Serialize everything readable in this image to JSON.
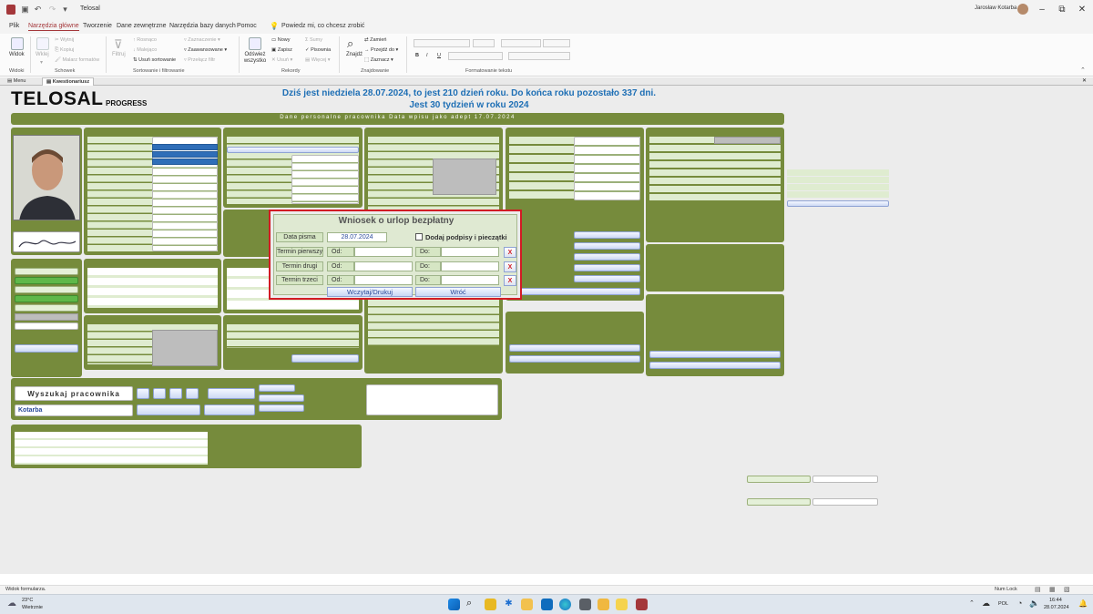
{
  "window": {
    "app_title": "Telosal",
    "user_name": "Jarosław Kotarba"
  },
  "ribbon": {
    "tabs": [
      "Plik",
      "Narzędzia główne",
      "Tworzenie",
      "Dane zewnętrzne",
      "Narzędzia bazy danych",
      "Pomoc"
    ],
    "active_tab": "Narzędzia główne",
    "tell_me": "Powiedz mi, co chcesz zrobić",
    "groups": {
      "widoki": {
        "label": "Widoki",
        "view_button": "Widok"
      },
      "schowek": {
        "label": "Schowek",
        "paste": "Wklej",
        "cut": "Wytnij",
        "copy": "Kopiuj",
        "format_painter": "Malarz formatów"
      },
      "sortowanie": {
        "label": "Sortowanie i filtrowanie",
        "filter": "Filtruj",
        "asc": "Rosnąco",
        "desc": "Malejąco",
        "remove_sort": "Usuń sortowanie",
        "selection": "Zaznaczenie",
        "advanced": "Zaawansowane",
        "toggle_filter": "Przełącz filtr"
      },
      "rekordy": {
        "label": "Rekordy",
        "refresh": "Odśwież wszystko",
        "new": "Nowy",
        "save": "Zapisz",
        "delete": "Usuń",
        "totals": "Sumy",
        "spelling": "Pisownia",
        "more": "Więcej"
      },
      "znajdowanie": {
        "label": "Znajdowanie",
        "find": "Znajdź",
        "replace": "Zamień",
        "goto": "Przejdź do",
        "select": "Zaznacz"
      },
      "formatowanie": {
        "label": "Formatowanie tekstu",
        "bold": "B",
        "italic": "I",
        "underline": "U"
      }
    }
  },
  "doc_tabs": [
    "Menu",
    "Kwestionariusz"
  ],
  "active_doc_tab": "Kwestionariusz",
  "form": {
    "logo": "TELOSAL",
    "logo_sub": "PROGRESS",
    "date_line1": "Dziś jest niedziela 28.07.2024, to jest 210 dzień roku. Do końca roku pozostało 337 dni.",
    "date_line2": "Jest 30 tydzień w roku 2024",
    "section_header": "Dane personalne pracownika   Data wpisu jako adept 17.07.2024",
    "search_button": "Wyszukaj pracownika",
    "search_value": "Kotarba"
  },
  "dialog": {
    "title": "Wniosek o urlop bezpłatny",
    "date_label": "Data pisma",
    "date_value": "28.07.2024",
    "checkbox_label": "Dodaj podpisy i pieczątki",
    "rows": [
      {
        "label": "Termin pierwszy",
        "od": "Od:",
        "do": "Do:"
      },
      {
        "label": "Termin drugi",
        "od": "Od:",
        "do": "Do:"
      },
      {
        "label": "Termin trzeci",
        "od": "Od:",
        "do": "Do:"
      }
    ],
    "x_label": "X",
    "load_print_button": "Wczytaj/Drukuj",
    "back_button": "Wróć"
  },
  "status": {
    "left": "Widok formularza.",
    "num_lock": "Num Lock"
  },
  "taskbar": {
    "weather_temp": "23°C",
    "weather_desc": "Wietrznie",
    "lang": "POL",
    "time": "16:44",
    "date": "28.07.2024"
  }
}
